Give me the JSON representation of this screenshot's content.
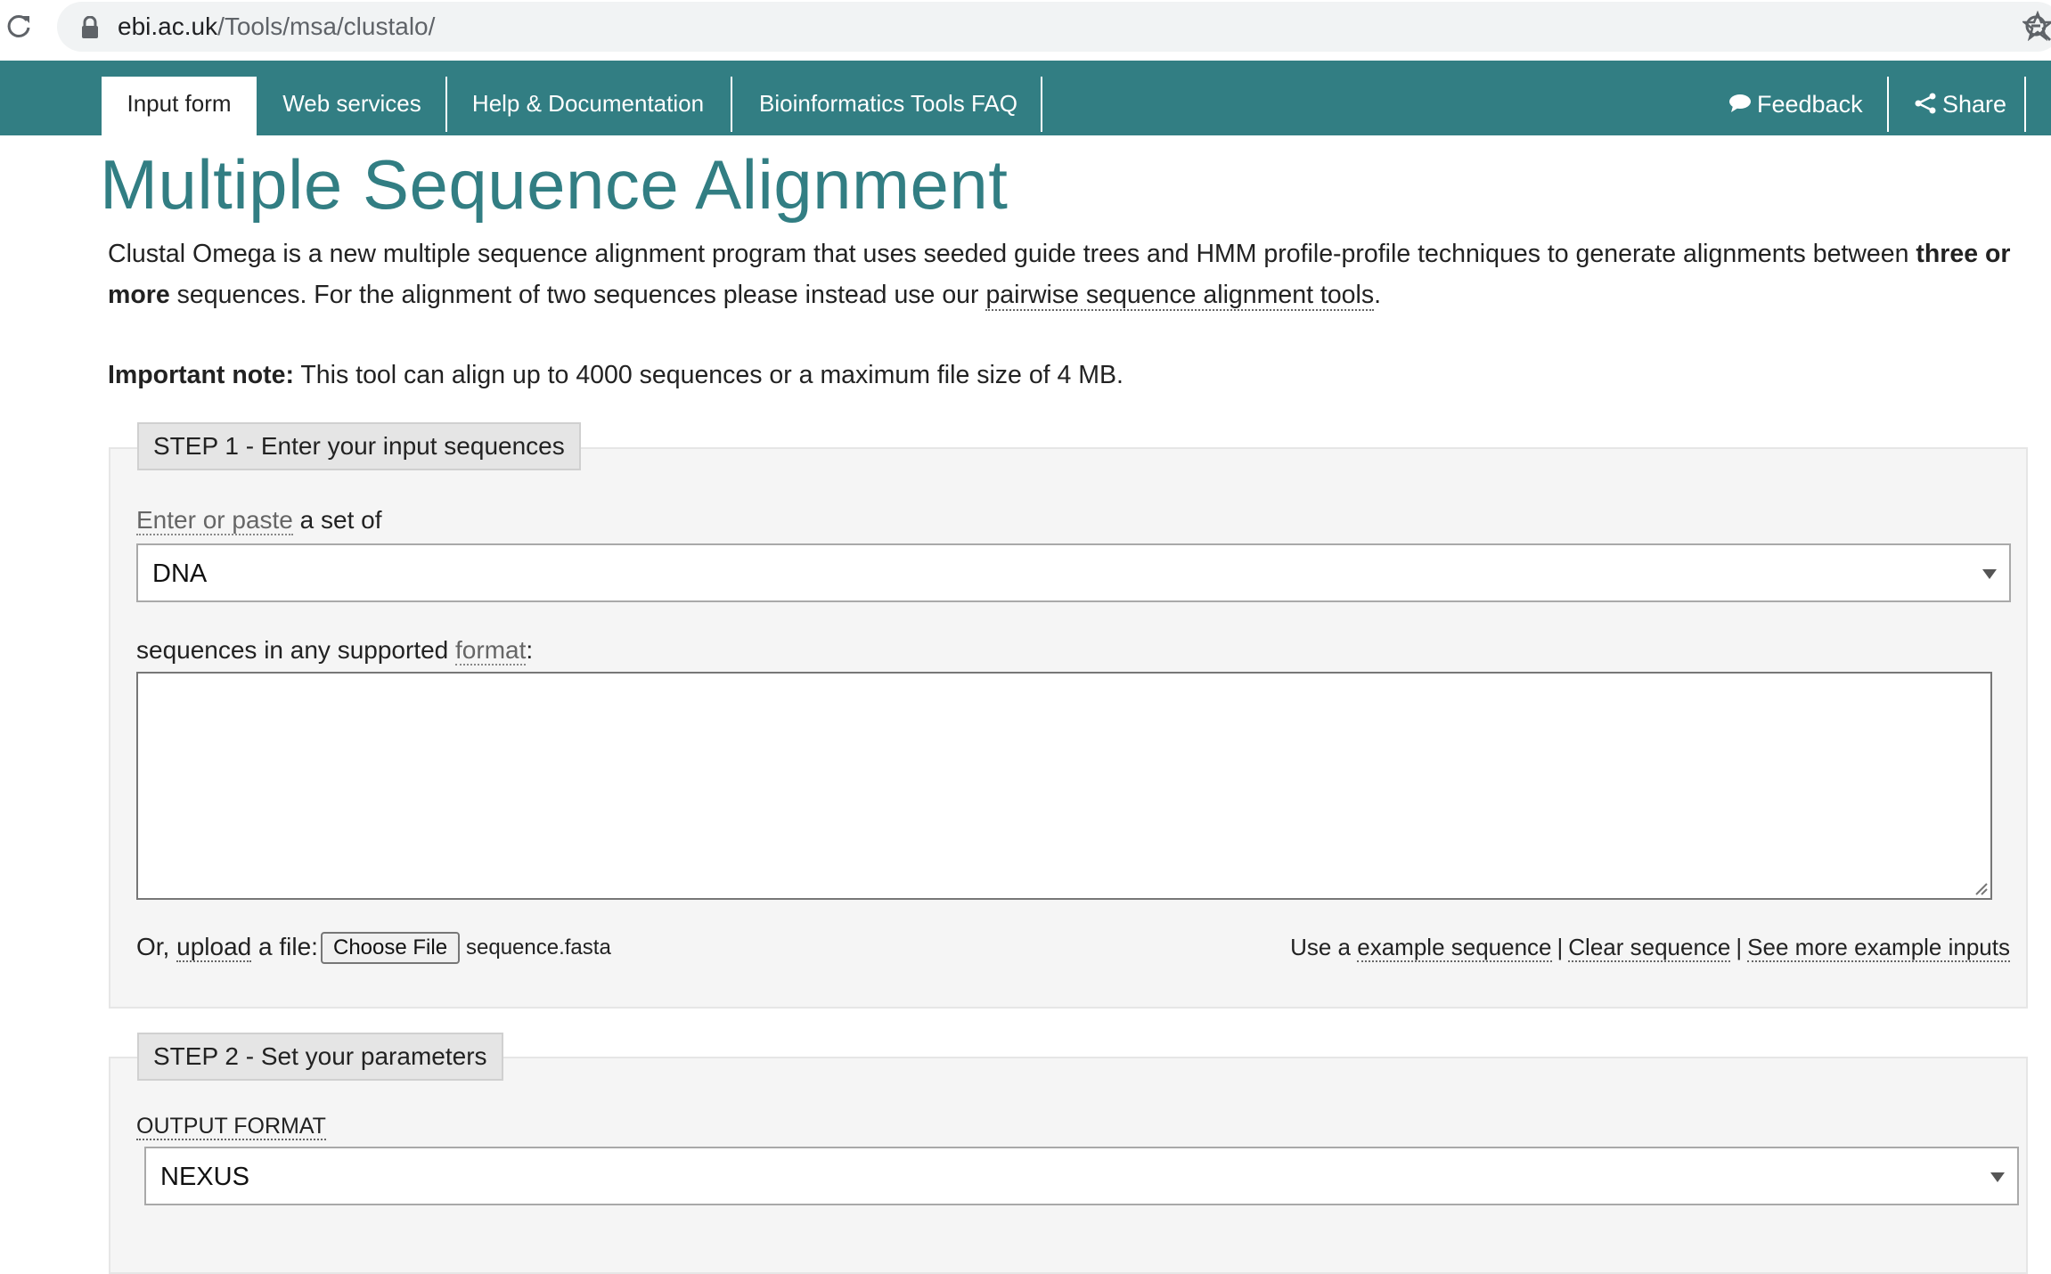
{
  "browser": {
    "url_host": "ebi.ac.uk",
    "url_path": "/Tools/msa/clustalo/",
    "icons": {
      "reload": "reload-icon",
      "lock": "lock-icon",
      "zoom": "zoom-icon",
      "bookmark": "star-icon"
    }
  },
  "nav": {
    "tabs": [
      {
        "label": "Input form",
        "active": true
      },
      {
        "label": "Web services"
      },
      {
        "label": "Help & Documentation"
      },
      {
        "label": "Bioinformatics Tools FAQ"
      }
    ],
    "feedback_label": "Feedback",
    "share_label": "Share"
  },
  "page": {
    "title": "Multiple Sequence Alignment",
    "intro": {
      "part1": "Clustal Omega is a new multiple sequence alignment program that uses seeded guide trees and HMM profile-profile techniques to generate alignments between ",
      "bold": "three or more",
      "part2": " sequences. For the alignment of two sequences please instead use our ",
      "link": "pairwise sequence alignment tools",
      "part3": "."
    },
    "note": {
      "bold": "Important note:",
      "text": " This tool can align up to 4000 sequences or a maximum file size of 4 MB."
    }
  },
  "step1": {
    "legend": "STEP 1 - Enter your input sequences",
    "enter_link": "Enter or paste",
    "enter_rest": " a set of",
    "sequence_type": "DNA",
    "seq_label_pre": "sequences in any supported ",
    "seq_label_link": "format",
    "seq_label_post": ":",
    "textarea_value": "",
    "upload_pre": "Or, ",
    "upload_link": "upload",
    "upload_post": " a file:",
    "choose_file": "Choose File",
    "file_name": "sequence.fasta",
    "use_a": "Use a ",
    "example_link": "example sequence",
    "pipe": "|",
    "clear_link": "Clear sequence",
    "more_link": "See more example inputs"
  },
  "step2": {
    "legend": "STEP 2 - Set your parameters",
    "output_label": "OUTPUT FORMAT",
    "output_value": "NEXUS"
  }
}
